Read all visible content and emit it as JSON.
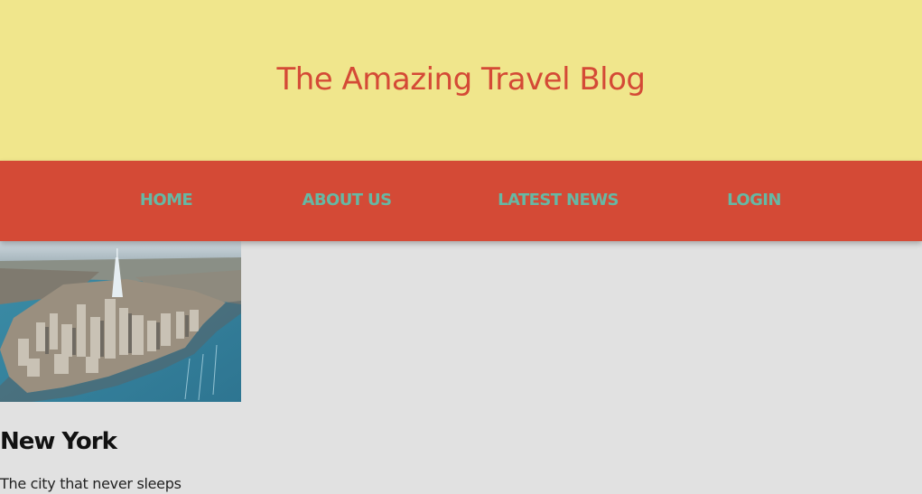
{
  "header": {
    "title": "The Amazing Travel Blog"
  },
  "nav": {
    "items": [
      {
        "label": "HOME"
      },
      {
        "label": "ABOUT US"
      },
      {
        "label": "LATEST NEWS"
      },
      {
        "label": "LOGIN"
      }
    ]
  },
  "article": {
    "image_subject": "aerial view of Manhattan skyline",
    "title": "New York",
    "excerpt": "The city that never sleeps"
  },
  "colors": {
    "header_bg": "#f0e68c",
    "title_color": "#d44a36",
    "nav_bg": "#d44a36",
    "nav_link_color": "#66b8a4",
    "page_bg": "#e1e1e1"
  }
}
